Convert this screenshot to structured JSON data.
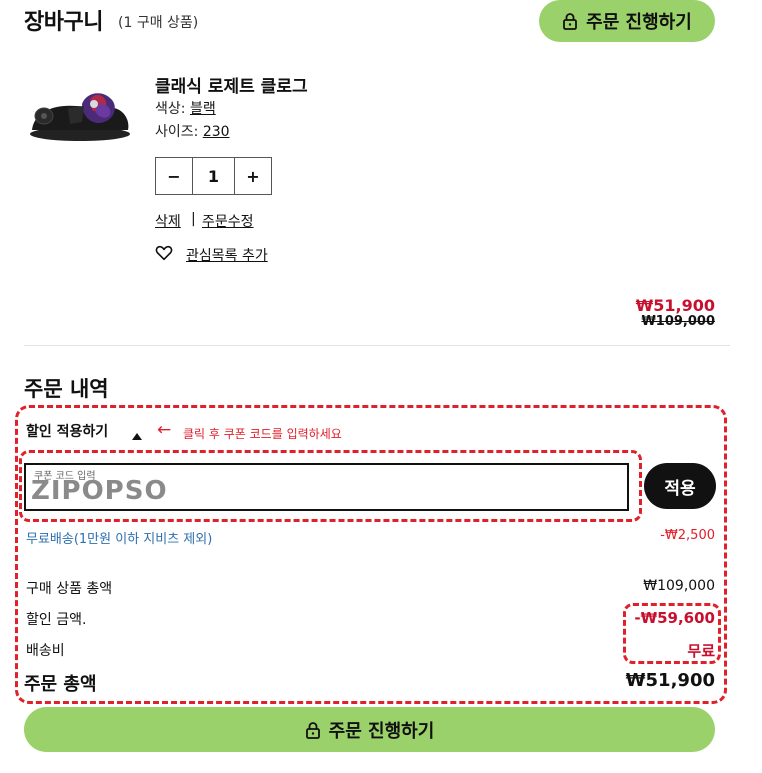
{
  "header": {
    "title": "장바구니",
    "count_text": "(1 구매 상품)",
    "checkout_label": "주문 진행하기"
  },
  "product": {
    "name": "클래식 로제트 클로그",
    "color_label": "색상:",
    "color_value": "블랙",
    "size_label": "사이즈:",
    "size_value": "230",
    "quantity": "1",
    "minus": "−",
    "plus": "+",
    "delete_label": "삭제",
    "separator": "|",
    "edit_label": "주문수정",
    "wishlist_label": "관심목록 추가",
    "sale_price": "₩51,900",
    "original_price": "₩109,000"
  },
  "summary": {
    "title": "주문 내역",
    "discount_toggle": "할인 적용하기",
    "hint_arrow": "←",
    "hint_text": "클릭 후 쿠폰 코드를 입력하세요",
    "coupon_label": "쿠폰 코드 입력",
    "coupon_value": "ZIPOPSO",
    "apply_label": "적용",
    "free_ship_text": "무료배송(1만원 이하 지비츠 제외)",
    "free_ship_amount": "-₩2,500",
    "subtotal_label": "구매 상품 총액",
    "subtotal_value": "₩109,000",
    "discount_label": "할인 금액.",
    "discount_value": "-₩59,600",
    "shipping_label": "배송비",
    "shipping_value": "무료",
    "total_label": "주문 총액",
    "total_value": "₩51,900",
    "checkout_label": "주문 진행하기"
  },
  "colors": {
    "accent_green": "#9bd16a",
    "sale_red": "#c8102e",
    "annotation_red": "#e0202a",
    "link_blue": "#2d6fb0"
  },
  "icons": [
    "lock-icon",
    "heart-icon",
    "caret-up-icon",
    "arrow-left-icon"
  ]
}
